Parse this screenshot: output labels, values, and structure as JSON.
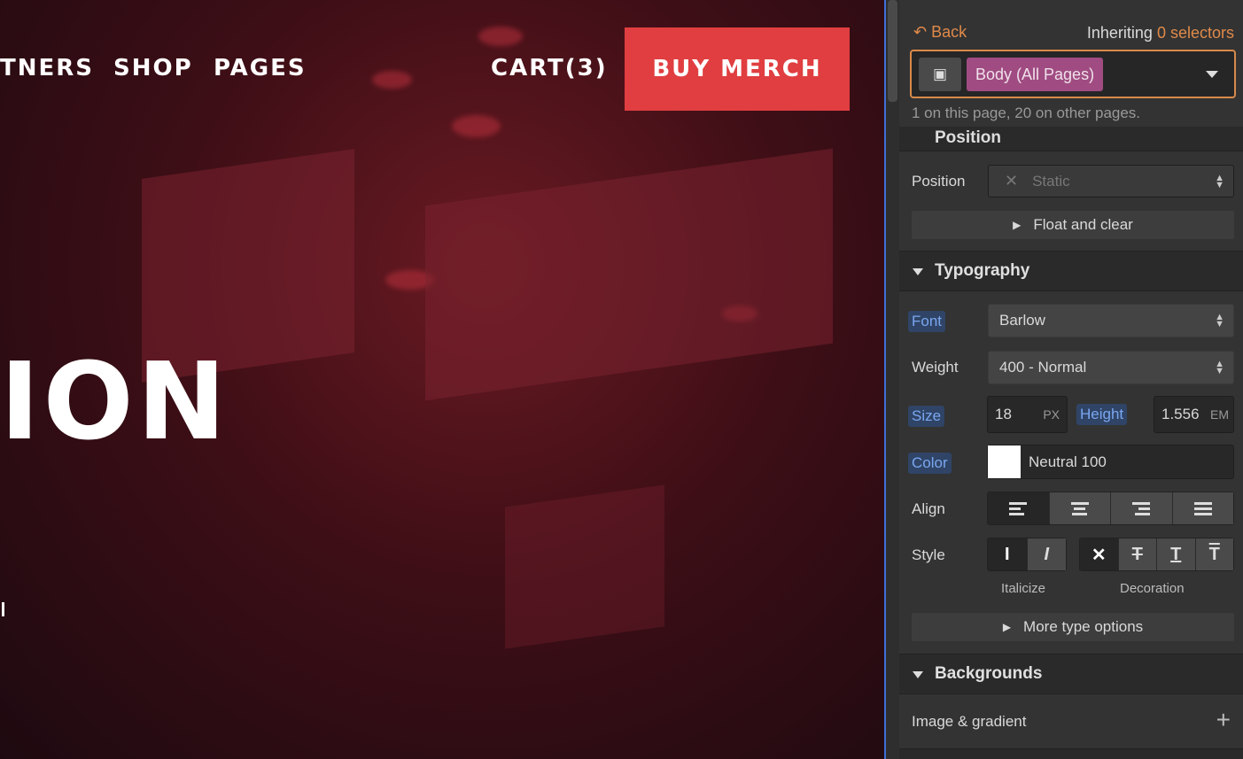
{
  "canvas": {
    "nav": [
      "TNERS",
      "SHOP",
      "PAGES"
    ],
    "cart": "CART(3)",
    "buy_button": "BUY MERCH",
    "hero_text": "ION",
    "accent": "#e03e40"
  },
  "panel": {
    "back": "Back",
    "inheriting": "Inheriting",
    "selectors": "0 selectors",
    "selector_tag": "Body (All Pages)",
    "selector_info": "1 on this page, 20 on other pages.",
    "position_section_partial": "Position",
    "position": {
      "label": "Position",
      "value": "Static"
    },
    "float_clear": "Float and clear",
    "typography": {
      "title": "Typography",
      "font_label": "Font",
      "font": "Barlow",
      "weight_label": "Weight",
      "weight": "400 - Normal",
      "size_label": "Size",
      "size": "18",
      "size_unit": "PX",
      "height_label": "Height",
      "height": "1.556",
      "height_unit": "EM",
      "color_label": "Color",
      "color": "Neutral 100",
      "color_hex": "#ffffff",
      "align_label": "Align",
      "style_label": "Style",
      "italicize": "Italicize",
      "decoration": "Decoration",
      "more": "More type options"
    },
    "backgrounds": {
      "title": "Backgrounds",
      "image_gradient": "Image & gradient"
    }
  }
}
